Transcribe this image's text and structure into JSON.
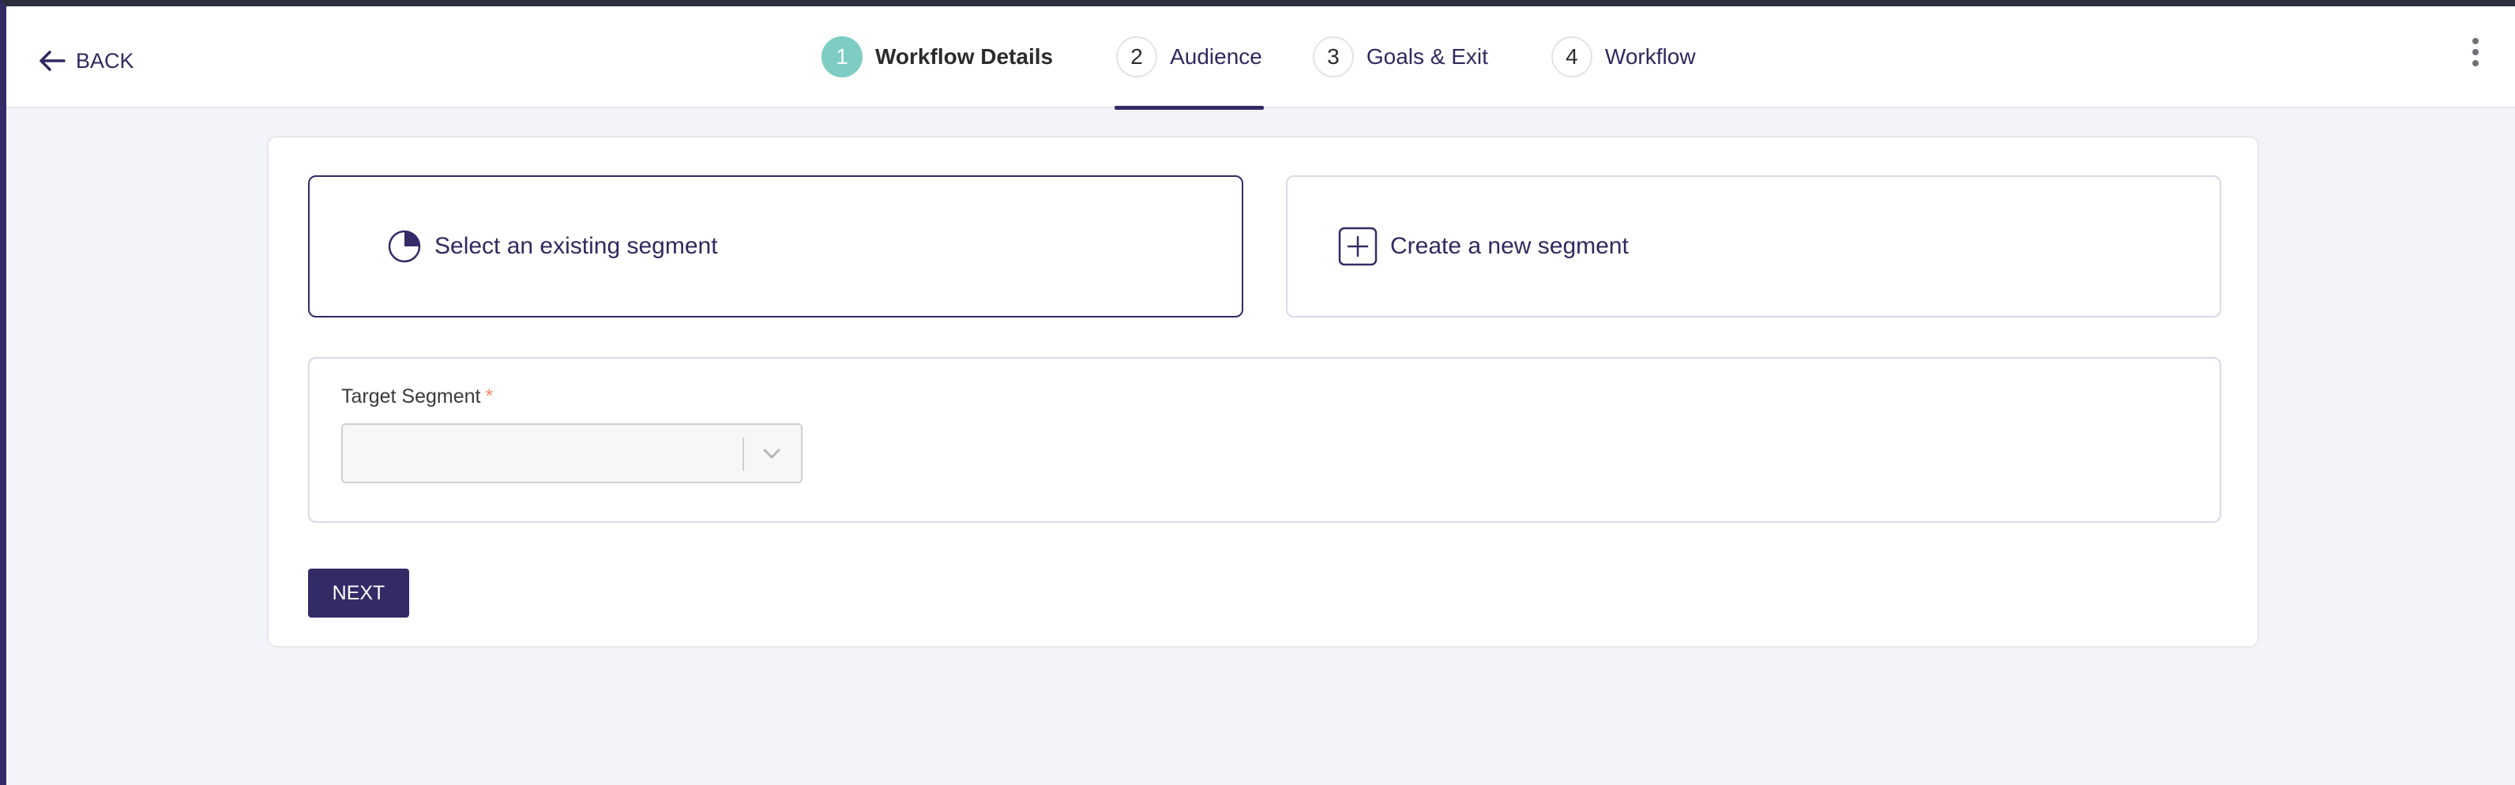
{
  "header": {
    "back_label": "BACK",
    "steps": [
      {
        "number": "1",
        "label": "Workflow Details",
        "state": "completed"
      },
      {
        "number": "2",
        "label": "Audience",
        "state": "active"
      },
      {
        "number": "3",
        "label": "Goals & Exit",
        "state": "upcoming"
      },
      {
        "number": "4",
        "label": "Workflow",
        "state": "upcoming"
      }
    ],
    "menu_icon": "kebab-vertical-icon"
  },
  "audience": {
    "options": [
      {
        "label": "Select an existing segment",
        "icon": "pie-chart-icon",
        "selected": true
      },
      {
        "label": "Create a new segment",
        "icon": "plus-square-icon",
        "selected": false
      }
    ],
    "target_segment": {
      "label": "Target Segment",
      "required_marker": "*",
      "value": ""
    },
    "next_label": "NEXT"
  },
  "colors": {
    "primary": "#332b66",
    "completed_step": "#7dcdc3",
    "required": "#f08a63",
    "background": "#f3f4f9"
  }
}
